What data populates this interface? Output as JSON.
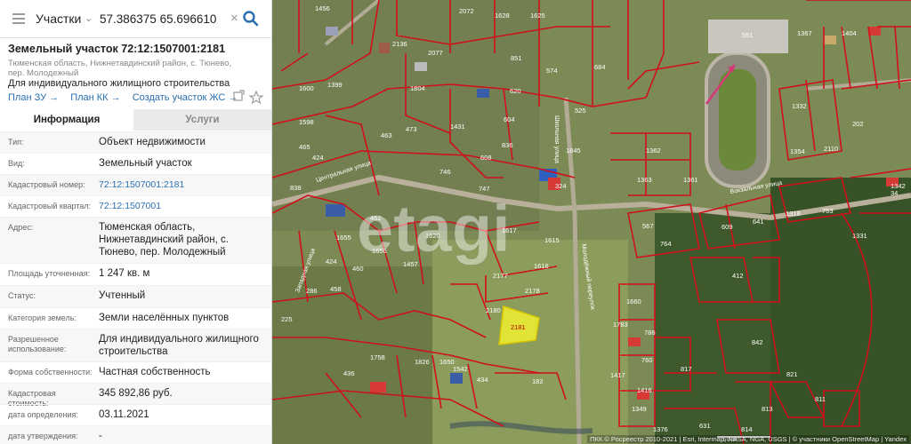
{
  "search": {
    "layer": "Участки",
    "value": "57.386375 65.696610"
  },
  "parcel": {
    "title": "Земельный участок 72:12:1507001:2181",
    "address_short": "Тюменская область, Нижнетавдинский район, с. Тюнево, пер. Молодежный",
    "purpose": "Для индивидуального жилищного строительства",
    "links": [
      "План ЗУ →",
      "План КК →",
      "Создать участок ЖС →"
    ]
  },
  "tabs": {
    "info": "Информация",
    "services": "Услуги"
  },
  "rows": [
    {
      "k": "Тип:",
      "v": "Объект недвижимости"
    },
    {
      "k": "Вид:",
      "v": "Земельный участок"
    },
    {
      "k": "Кадастровый номер:",
      "v": "72:12:1507001:2181"
    },
    {
      "k": "Кадастровый квартал:",
      "v": "72:12:1507001"
    },
    {
      "k": "Адрес:",
      "v": "Тюменская область, Нижнетавдинский район, с. Тюнево, пер. Молодежный"
    },
    {
      "k": "Площадь уточненная:",
      "v": "1 247 кв. м"
    },
    {
      "k": "Статус:",
      "v": "Учтенный"
    },
    {
      "k": "Категория земель:",
      "v": "Земли населённых пунктов"
    },
    {
      "k": "Разрешенное использование:",
      "v": "Для индивидуального жилищного строительства"
    },
    {
      "k": "Форма собственности:",
      "v": "Частная собственность"
    },
    {
      "k": "Кадастровая стоимость:",
      "v": "345 892,86 руб."
    },
    {
      "k": "дата определения:",
      "v": "03.11.2021"
    },
    {
      "k": "дата утверждения:",
      "v": "-"
    }
  ],
  "map": {
    "watermark": "etagi",
    "selected_parcel": "2181",
    "scale": "50 м",
    "attribution": "ПКК © Росреестр 2010-2021 | Esri, Intermap, NASA, NGA, USGS | © участники OpenStreetMap | Yandex",
    "streets": [
      "Центральная улица",
      "Школьная улица",
      "Молодёжный переулок",
      "Западная улица",
      "Вокзальная улица"
    ],
    "labels": [
      "1456",
      "2072",
      "1628",
      "1625",
      "551",
      "1367",
      "1404",
      "2136",
      "2077",
      "851",
      "574",
      "684",
      "1600",
      "1399",
      "1804",
      "620",
      "525",
      "1332",
      "202",
      "1598",
      "473",
      "1431",
      "604",
      "1845",
      "1362",
      "465",
      "424",
      "463",
      "836",
      "608",
      "746",
      "747",
      "324",
      "1354",
      "2110",
      "838",
      "1363",
      "1361",
      "1318",
      "753",
      "34",
      "1342",
      "462",
      "1620",
      "1617",
      "1615",
      "567",
      "609",
      "641",
      "1331",
      "1655",
      "1656",
      "1616",
      "764",
      "1457",
      "424",
      "460",
      "2177",
      "2178",
      "412",
      "286",
      "458",
      "2180",
      "2181",
      "1660",
      "1783",
      "225",
      "786",
      "842",
      "1758",
      "1826",
      "1650",
      "760",
      "436",
      "1542",
      "434",
      "1417",
      "1416",
      "817",
      "182",
      "821",
      "631",
      "813",
      "811",
      "1349",
      "814",
      "1376"
    ],
    "accent_red": "#d0101a",
    "selected_fill": "#f0f030"
  }
}
